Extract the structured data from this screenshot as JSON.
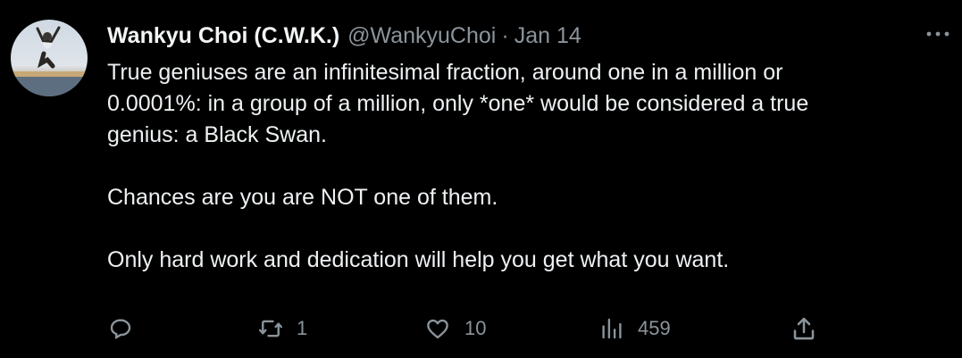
{
  "tweet": {
    "author_name": "Wankyu Choi (C.W.K.)",
    "handle": "@WankyuChoi",
    "separator": "·",
    "date": "Jan 14",
    "more_icon": "ellipsis-icon",
    "text_lines": [
      "True geniuses are an infinitesimal fraction, around one in a million or",
      "0.0001%: in a group of a million, only *one* would be considered a true",
      "genius:  a Black Swan."
    ],
    "paragraph_2": "Chances are you are NOT one of them.",
    "paragraph_3": "Only hard work and dedication will help you get what you want."
  },
  "actions": {
    "reply": {
      "icon": "reply-icon",
      "count": ""
    },
    "retweet": {
      "icon": "retweet-icon",
      "count": "1"
    },
    "like": {
      "icon": "heart-icon",
      "count": "10"
    },
    "views": {
      "icon": "views-chart-icon",
      "count": "459"
    },
    "share": {
      "icon": "share-icon",
      "count": ""
    }
  },
  "colors": {
    "background": "#000000",
    "text": "#e7e9ea",
    "muted": "#8b949b"
  }
}
